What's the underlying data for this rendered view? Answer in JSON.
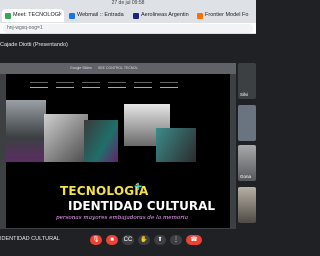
{
  "system": {
    "datetime": "27 de jul  09:58"
  },
  "tabs": [
    {
      "label": "Meet: TECNOLOGÍ",
      "active": true,
      "icon": "meet-icon",
      "color": "#34a853"
    },
    {
      "label": "Webmail :: Entrada",
      "active": false,
      "icon": "mail-icon",
      "color": "#1a73e8"
    },
    {
      "label": "Aerolineas Argentin",
      "active": false,
      "icon": "plane-icon",
      "color": "#1a237e"
    },
    {
      "label": "Frontier Model Fo",
      "active": false,
      "icon": "doc-icon",
      "color": "#ff6d00"
    }
  ],
  "address": {
    "url": "hnj-wgsq-oog=1"
  },
  "presenter": {
    "label": "Cajade Diotti (Presentando)"
  },
  "slide": {
    "top_left": "Google Slides",
    "top_center": "SEE CONTROL TECNOL",
    "title_line1": "TECNOLOGÍA",
    "plus": "+",
    "title_line2": "IDENTIDAD CULTURAL",
    "subtitle": "personas mayores embajadoras de la memoria"
  },
  "participants": [
    {
      "name": "Silvi",
      "icon": "person-icon"
    },
    {
      "name": "",
      "icon": "person-icon"
    },
    {
      "name": "Gona",
      "icon": "person-icon"
    },
    {
      "name": "",
      "icon": "person-icon"
    }
  ],
  "footer": {
    "meeting_name": "IDENTIDAD CULTURAL"
  },
  "controls": {
    "mic": "🎙",
    "cam": "■",
    "cc": "CC",
    "hand": "✋",
    "present": "⬆",
    "more": "⋮",
    "leave": "☎"
  }
}
